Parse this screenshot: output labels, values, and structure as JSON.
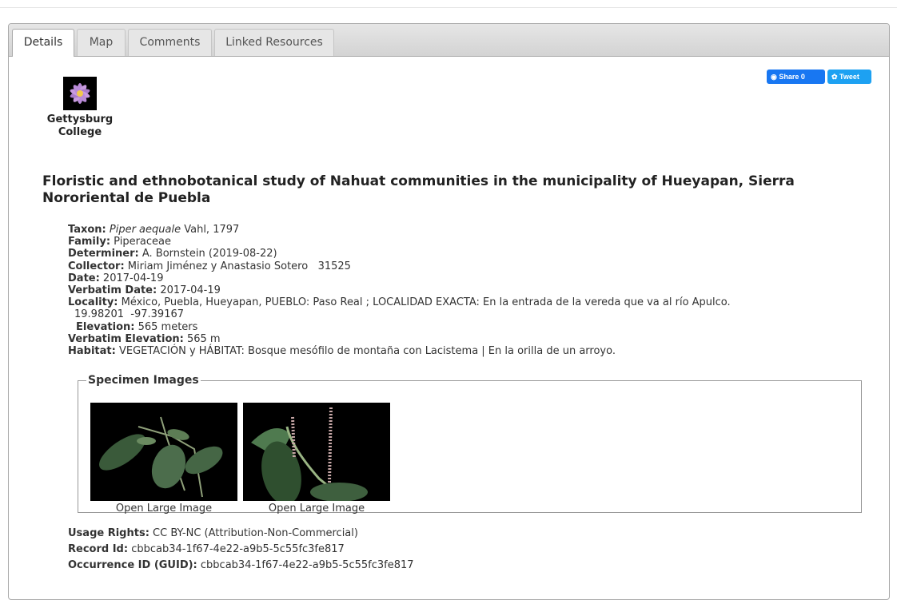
{
  "tabs": [
    "Details",
    "Map",
    "Comments",
    "Linked Resources"
  ],
  "institution": {
    "name_line1": "Gettysburg",
    "name_line2": "College",
    "logo_icon": "flower-logo-icon"
  },
  "share": {
    "facebook_label": "Share 0",
    "twitter_label": "Tweet",
    "facebook_color": "#1877f2",
    "twitter_color": "#1da1f2"
  },
  "title": "Floristic and ethnobotanical study of Nahuat communities in the municipality of Hueyapan, Sierra Nororiental de Puebla",
  "fields": {
    "taxon_label": "Taxon:",
    "taxon_name": "Piper aequale",
    "taxon_author": " Vahl, 1797",
    "family_label": "Family:",
    "family_value": " Piperaceae",
    "determiner_label": "Determiner:",
    "determiner_value": " A. Bornstein (2019-08-22)",
    "collector_label": "Collector:",
    "collector_value": " Miriam Jiménez y Anastasio Sotero   31525",
    "date_label": "Date:",
    "date_value": " 2017-04-19",
    "verbatim_date_label": "Verbatim Date:",
    "verbatim_date_value": " 2017-04-19",
    "locality_label": "Locality:",
    "locality_value": " México, Puebla, Hueyapan, PUEBLO: Paso Real ; LOCALIDAD EXACTA: En la entrada de la vereda que va al río Apulco.",
    "coordinates": "19.98201  -97.39167",
    "elevation_label": "Elevation:",
    "elevation_value": " 565 meters",
    "verbatim_elevation_label": "Verbatim Elevation:",
    "verbatim_elevation_value": " 565 m",
    "habitat_label": "Habitat:",
    "habitat_value": " VEGETACIÓN y HÁBITAT: Bosque mesófilo de montaña con Lacistema | En la orilla de un arroyo."
  },
  "specimen_images": {
    "legend": "Specimen Images",
    "images": [
      {
        "link_label": "Open Large Image"
      },
      {
        "link_label": "Open Large Image"
      }
    ]
  },
  "usage_rights_label": "Usage Rights:",
  "usage_rights_value": " CC BY-NC (Attribution-Non-Commercial)",
  "record_id_label": "Record Id:",
  "record_id_value": " cbbcab34-1f67-4e22-a9b5-5c55fc3fe817",
  "occurrence_id_label": "Occurrence ID (GUID):",
  "occurrence_id_value": " cbbcab34-1f67-4e22-a9b5-5c55fc3fe817"
}
